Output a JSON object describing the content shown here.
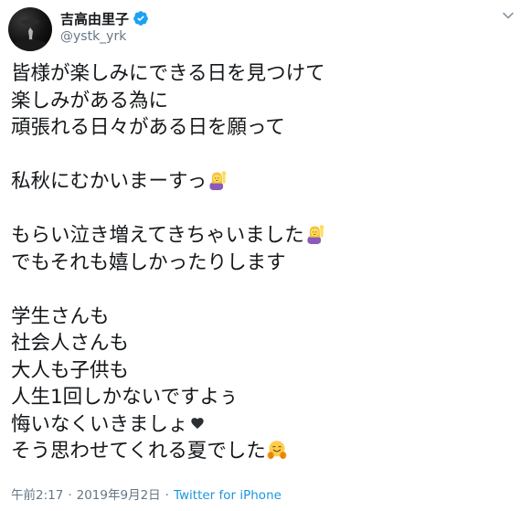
{
  "author": {
    "display_name": "吉高由里子",
    "handle": "@ystk_yrk",
    "verified": true,
    "avatar_icon": "profile-avatar"
  },
  "tweet": {
    "lines": [
      "皆様が楽しみにできる日を見つけて",
      "楽しみがある為に",
      "頑張れる日々がある日を願って",
      "",
      "私秋にむかいまーすっ",
      "",
      "もらい泣き増えてきちゃいました",
      "でもそれも嬉しかったりします",
      "",
      "学生さんも",
      "社会人さんも",
      "大人も子供も",
      "人生1回しかないですよぅ",
      "悔いなくいきましょ",
      "そう思わせてくれる夏でした"
    ],
    "emojis": {
      "line_4": "person-raising-hand-emoji",
      "line_6": "person-raising-hand-emoji",
      "line_13": "black-heart-icon",
      "line_14": "hugging-face-emoji"
    }
  },
  "meta": {
    "time": "午前2:17",
    "separator": "·",
    "date": "2019年9月2日",
    "source": "Twitter for iPhone"
  },
  "colors": {
    "text": "#14171a",
    "secondary": "#657786",
    "link": "#1b95e0",
    "verified": "#1da1f2"
  }
}
